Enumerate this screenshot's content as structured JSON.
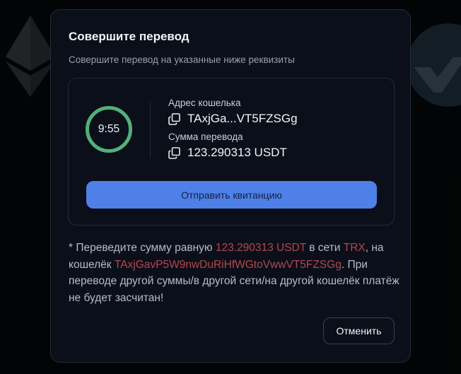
{
  "modal": {
    "title": "Совершите перевод",
    "subtitle": "Совершите перевод на указанные ниже реквизиты"
  },
  "payment": {
    "timer": "9:55",
    "address_label": "Адрес кошелька",
    "address_value": "TAxjGa...VT5FZSGg",
    "amount_label": "Сумма перевода",
    "amount_value": "123.290313 USDT",
    "send_receipt_label": "Отправить квитанцию"
  },
  "notice": {
    "part1": "* Переведите сумму равную ",
    "amount": "123.290313 USDT",
    "part2": " в сети ",
    "network": "TRX",
    "part3": ", на кошелёк ",
    "wallet": "TAxjGavP5W9nwDuRiHfWGtoVwwVT5FZSGg",
    "part4": ". При переводе другой суммы/в другой сети/на другой кошелёк платёж не будет засчитан!"
  },
  "actions": {
    "cancel_label": "Отменить"
  },
  "icons": {
    "copy": "copy-icon",
    "background_left": "ethereum-logo",
    "background_right": "checkmark-logo"
  },
  "colors": {
    "accent_button": "#4f80e8",
    "timer_ring": "#52b07a",
    "highlight": "#b5474c",
    "modal_bg": "#0b0f1a"
  }
}
